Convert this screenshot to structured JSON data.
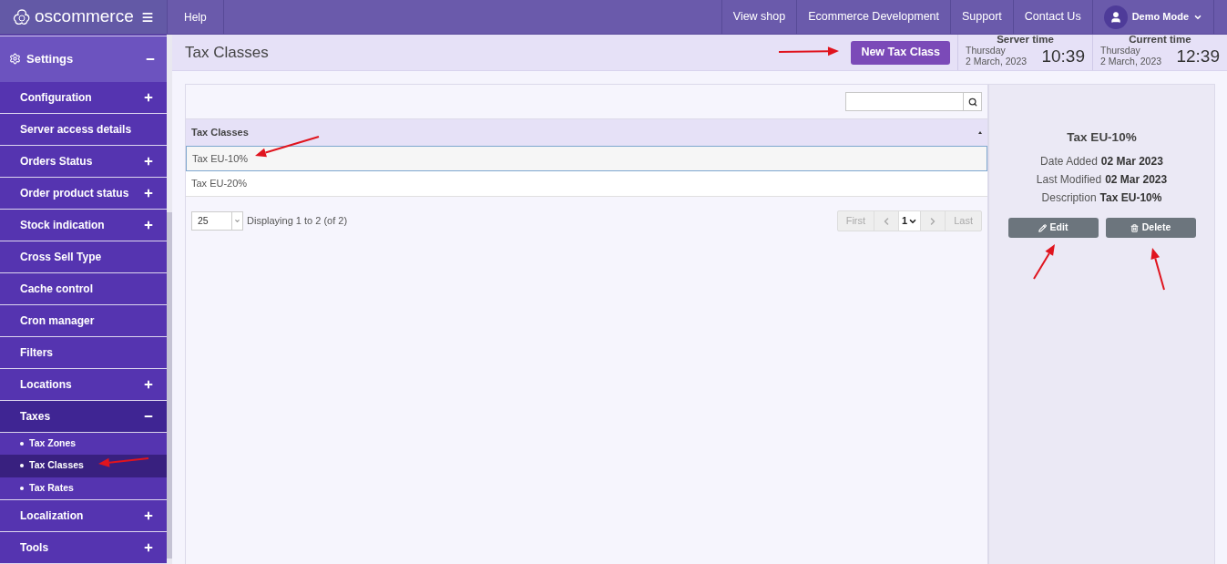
{
  "topbar": {
    "logo": "oscommerce",
    "links": [
      {
        "label": "Help"
      }
    ],
    "right_links": [
      {
        "label": "View shop"
      },
      {
        "label": "Ecommerce Development"
      },
      {
        "label": "Support"
      },
      {
        "label": "Contact Us"
      }
    ],
    "user": "Demo Mode"
  },
  "sidebar": {
    "section": "Settings",
    "expanded": true,
    "items": [
      {
        "label": "Configuration",
        "kind": "group",
        "expanded": false
      },
      {
        "label": "Server access details",
        "kind": "link"
      },
      {
        "label": "Orders Status",
        "kind": "group",
        "expanded": false
      },
      {
        "label": "Order product status",
        "kind": "group",
        "expanded": false
      },
      {
        "label": "Stock indication",
        "kind": "group",
        "expanded": false
      },
      {
        "label": "Cross Sell Type",
        "kind": "link"
      },
      {
        "label": "Cache control",
        "kind": "link"
      },
      {
        "label": "Cron manager",
        "kind": "link"
      },
      {
        "label": "Filters",
        "kind": "link"
      },
      {
        "label": "Locations",
        "kind": "group",
        "expanded": false
      },
      {
        "label": "Taxes",
        "kind": "group",
        "expanded": true,
        "children": [
          {
            "label": "Tax Zones",
            "selected": false
          },
          {
            "label": "Tax Classes",
            "selected": true
          },
          {
            "label": "Tax Rates",
            "selected": false
          }
        ]
      },
      {
        "label": "Localization",
        "kind": "group",
        "expanded": false
      },
      {
        "label": "Tools",
        "kind": "group",
        "expanded": false
      }
    ]
  },
  "page": {
    "title": "Tax Classes",
    "new_button": "New Tax Class"
  },
  "clocks": [
    {
      "label": "Server time",
      "day": "Thursday",
      "date": "2 March, 2023",
      "time": "10:39"
    },
    {
      "label": "Current time",
      "day": "Thursday",
      "date": "2 March, 2023",
      "time": "12:39"
    }
  ],
  "table": {
    "columns": [
      "Tax Classes"
    ],
    "rows": [
      {
        "name": "Tax EU-10%",
        "selected": true
      },
      {
        "name": "Tax EU-20%",
        "selected": false
      }
    ]
  },
  "pager": {
    "per_page": "25",
    "info": "Displaying 1 to 2 (of 2)",
    "first": "First",
    "page": "1",
    "last": "Last"
  },
  "details": {
    "title": "Tax EU-10%",
    "fields": [
      {
        "label": "Date Added",
        "value": "02 Mar 2023"
      },
      {
        "label": "Last Modified",
        "value": "02 Mar 2023"
      },
      {
        "label": "Description",
        "value": "Tax EU-10%"
      }
    ],
    "buttons": [
      {
        "label": "Edit",
        "kind": "edit"
      },
      {
        "label": "Delete",
        "kind": "delete"
      }
    ]
  }
}
